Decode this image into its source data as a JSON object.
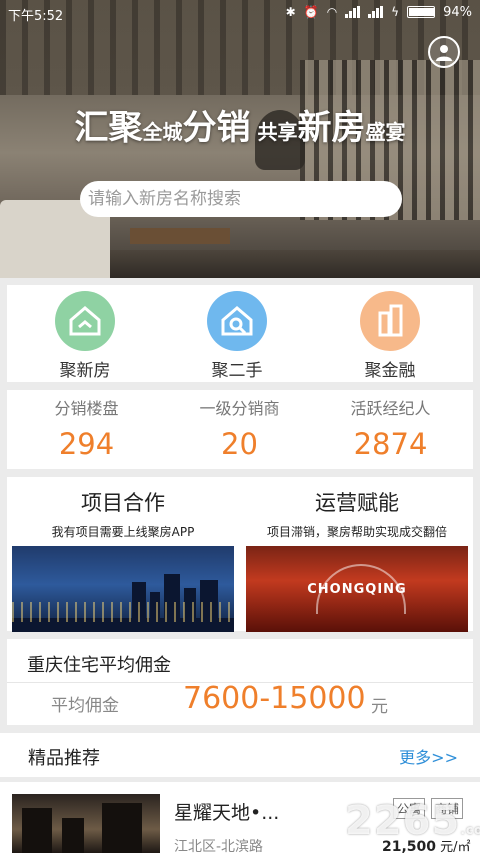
{
  "status_bar": {
    "time": "下午5:52",
    "battery": "94%",
    "battery_level": 0.94
  },
  "hero": {
    "slogan_parts": [
      {
        "text": "汇聚",
        "size": "big"
      },
      {
        "text": "全城",
        "size": "small"
      },
      {
        "text": "分销",
        "size": "big"
      },
      {
        "text": " 共享",
        "size": "small"
      },
      {
        "text": "新房",
        "size": "big"
      },
      {
        "text": "盛宴",
        "size": "small"
      }
    ],
    "search_placeholder": "请输入新房名称搜索"
  },
  "categories": [
    {
      "label": "聚新房",
      "icon": "new-house-icon",
      "color": "#8fd2a3"
    },
    {
      "label": "聚二手",
      "icon": "second-hand-icon",
      "color": "#6fb8ee"
    },
    {
      "label": "聚金融",
      "icon": "finance-icon",
      "color": "#f7b98a"
    }
  ],
  "stats": [
    {
      "label": "分销楼盘",
      "value": "294"
    },
    {
      "label": "一级分销商",
      "value": "20"
    },
    {
      "label": "活跃经纪人",
      "value": "2874"
    }
  ],
  "promos": [
    {
      "title": "项目合作",
      "subtitle": "我有项目需要上线聚房APP"
    },
    {
      "title": "运营赋能",
      "subtitle": "项目滞销，聚房帮助实现成交翻倍",
      "image_text": "CHONGQING"
    }
  ],
  "commission": {
    "title": "重庆住宅平均佣金",
    "label": "平均佣金",
    "value": "7600-15000",
    "unit": "元"
  },
  "featured": {
    "title": "精品推荐",
    "more": "更多>>",
    "items": [
      {
        "name": "星耀天地•...",
        "location": "江北区-北滨路",
        "tags": [
          "公寓",
          "商铺"
        ],
        "price": "21,500",
        "price_unit": "元/㎡起"
      }
    ]
  },
  "watermark": {
    "text": "2265",
    "suffix": ".com"
  },
  "colors": {
    "accent": "#ef7f2b",
    "link": "#2f8fd8"
  }
}
